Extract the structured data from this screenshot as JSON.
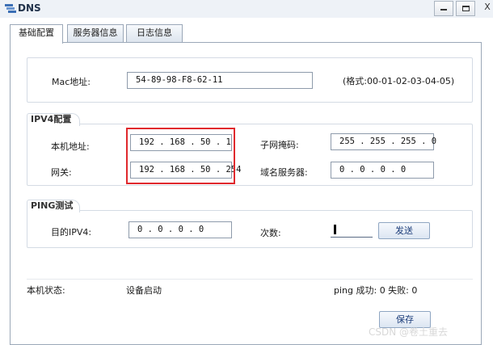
{
  "window": {
    "title": "DNS",
    "close_glyph": "X"
  },
  "tabs": [
    {
      "label": "基础配置"
    },
    {
      "label": "服务器信息"
    },
    {
      "label": "日志信息"
    }
  ],
  "mac": {
    "label": "Mac地址:",
    "value": "54-89-98-F8-62-11",
    "hint": "(格式:00-01-02-03-04-05)"
  },
  "ipv4": {
    "title": "IPV4配置",
    "local_ip_label": "本机地址:",
    "local_ip": "192 . 168 . 50 . 1",
    "gateway_label": "网关:",
    "gateway": "192 . 168 . 50 . 254",
    "subnet_label": "子网掩码:",
    "subnet": "255 . 255 . 255 . 0",
    "dns_label": "域名服务器:",
    "dns": "0 . 0 . 0 . 0"
  },
  "ping": {
    "title": "PING测试",
    "target_label": "目的IPV4:",
    "target": "0 . 0 . 0 . 0",
    "count_label": "次数:",
    "count": "",
    "send_label": "发送"
  },
  "status": {
    "label": "本机状态:",
    "value": "设备启动",
    "ping_result": "ping 成功: 0 失败: 0"
  },
  "save_label": "保存",
  "watermark": "CSDN @卷土重去",
  "colors": {
    "highlight": "#e0292d",
    "titlebar": "#eef2f7"
  }
}
